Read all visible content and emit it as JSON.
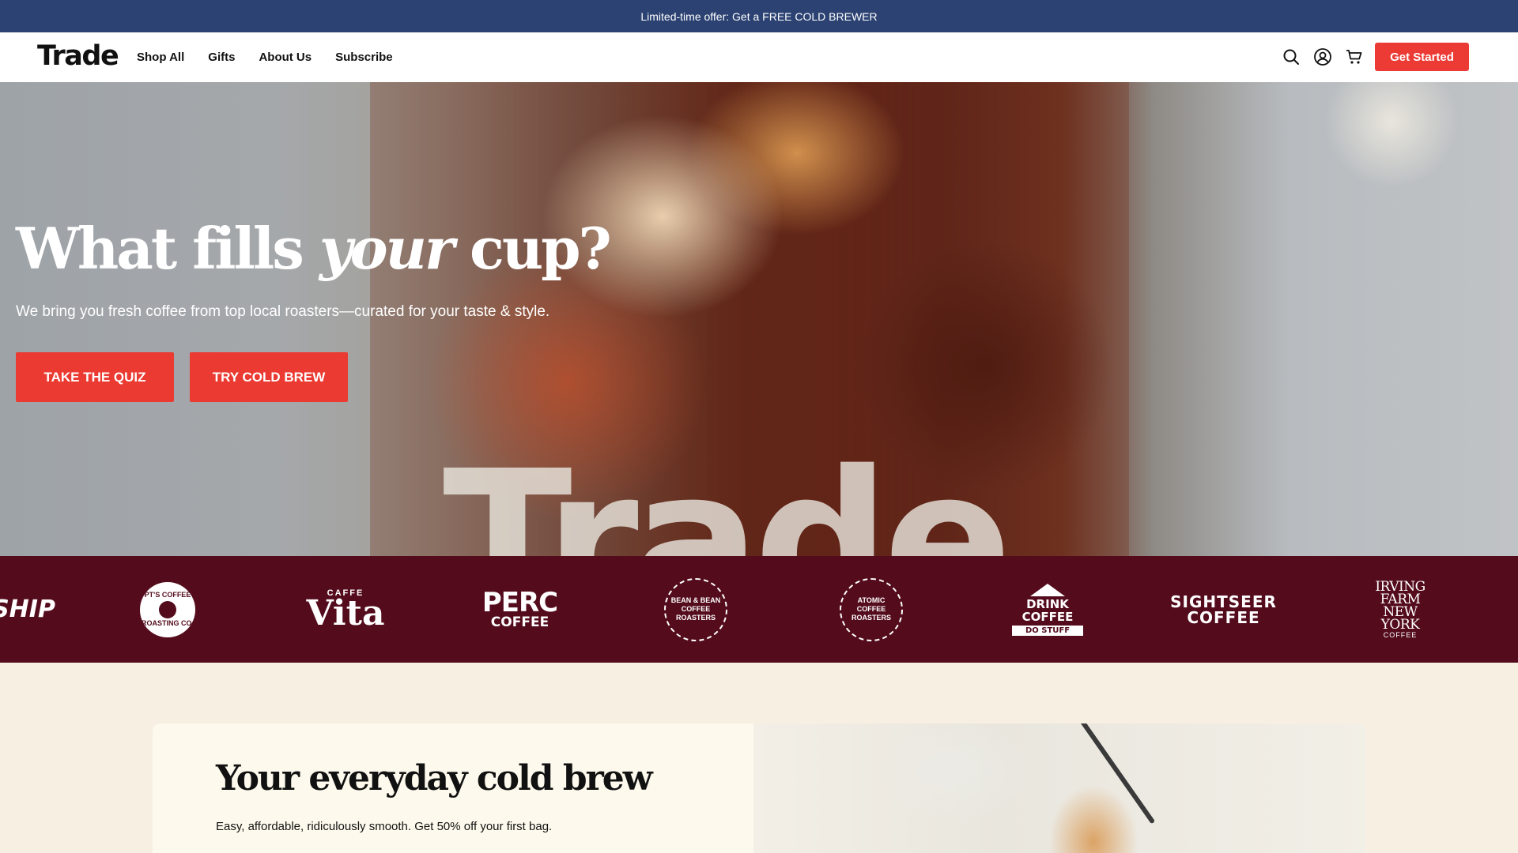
{
  "announcement": {
    "text": "Limited-time offer: Get a FREE COLD BREWER"
  },
  "header": {
    "logo": "Trade",
    "nav": [
      "Shop All",
      "Gifts",
      "About Us",
      "Subscribe"
    ],
    "icons": [
      "search-icon",
      "account-icon",
      "cart-icon"
    ],
    "cta": "Get Started"
  },
  "hero": {
    "title_before": "What fills ",
    "title_emphasis": "your",
    "title_after": " cup?",
    "subtitle": "We bring you fresh coffee from top local roasters—curated for your taste & style.",
    "buttons": [
      "TAKE THE QUIZ",
      "TRY COLD BREW"
    ],
    "glass_print": "Trade"
  },
  "roasters": {
    "ship": "SHIP",
    "pts": {
      "top": "PT'S COFFEE",
      "bottom": "ROASTING CO."
    },
    "vita": {
      "top": "CAFFE",
      "main": "Vita"
    },
    "perc": {
      "main": "PERC",
      "sub": "COFFEE"
    },
    "bean": {
      "top": "BEAN & BEAN",
      "bottom": "COFFEE ROASTERS"
    },
    "atomic": {
      "top": "ATOMIC COFFEE",
      "bottom": "ROASTERS"
    },
    "drink": {
      "main": "DRINK COFFEE",
      "sub": "DO STUFF"
    },
    "sightseer": {
      "top": "SIGHTSEER",
      "bottom": "COFFEE"
    },
    "irving": {
      "line1": "IRVING FARM",
      "line2": "NEW YORK",
      "line3": "COFFEE"
    }
  },
  "colors": {
    "announce_bg": "#2b4272",
    "accent": "#ea3a31",
    "strip_bg": "#540c1d",
    "page_bg": "#f8efe3"
  },
  "product": {
    "title": "Your everyday cold brew",
    "description": "Easy, affordable, ridiculously smooth. Get 50% off your first bag."
  }
}
